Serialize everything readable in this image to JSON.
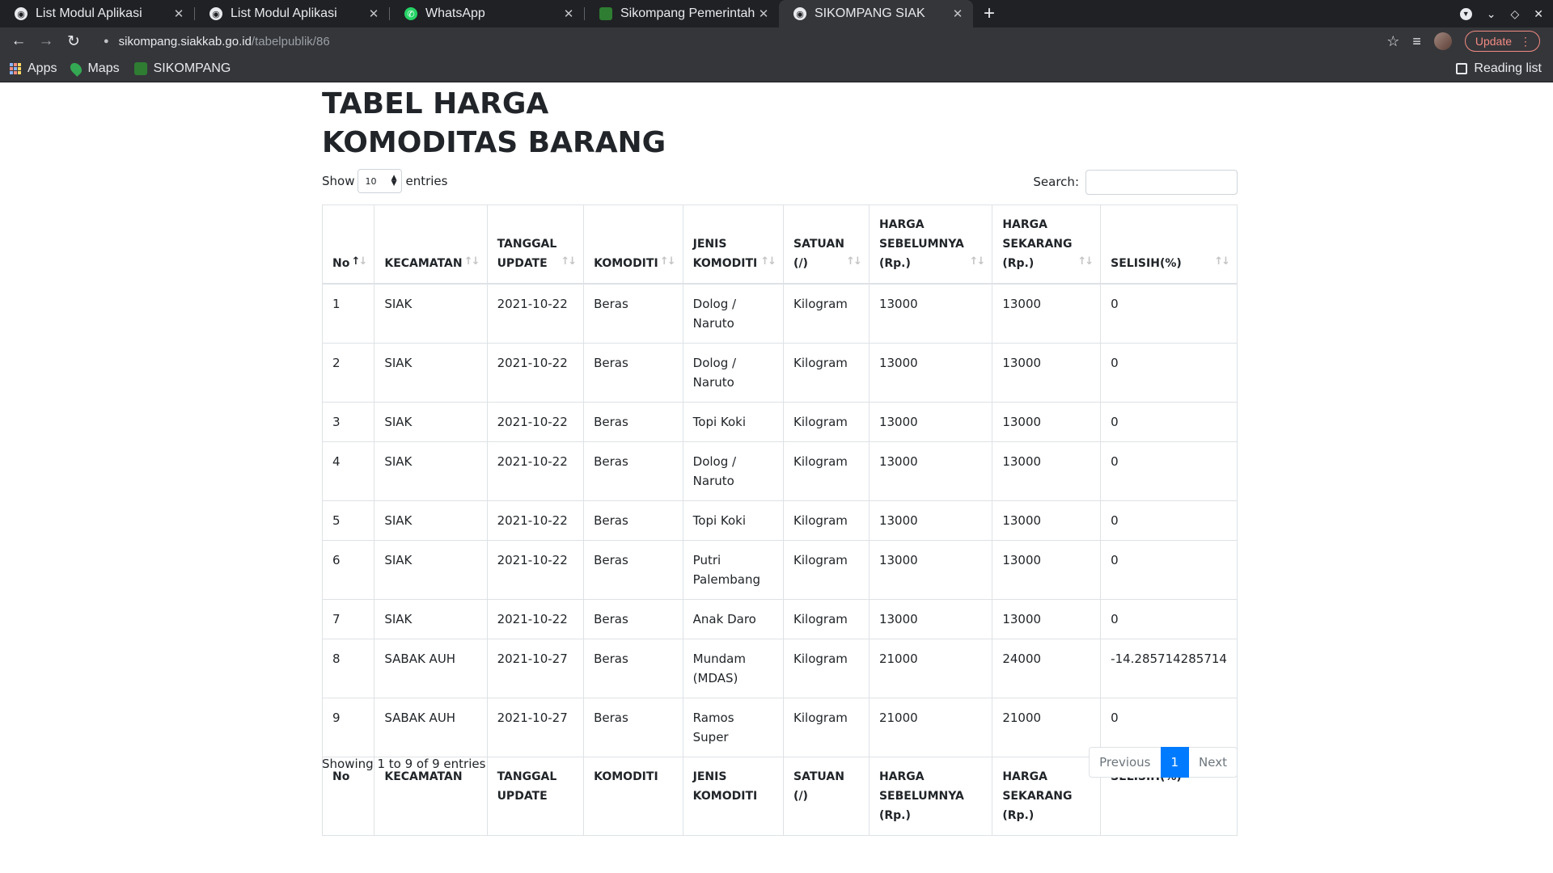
{
  "browser": {
    "tabs": [
      {
        "title": "List Modul Aplikasi",
        "icon": "globe-icon",
        "active": false
      },
      {
        "title": "List Modul Aplikasi",
        "icon": "globe-icon",
        "active": false
      },
      {
        "title": "WhatsApp",
        "icon": "whatsapp-icon",
        "active": false
      },
      {
        "title": "Sikompang Pemerintah K",
        "icon": "sikompang-icon",
        "active": false
      },
      {
        "title": "SIKOMPANG SIAK",
        "icon": "globe-icon",
        "active": true
      }
    ],
    "url_host": "sikompang.siakkab.go.id",
    "url_path": "/tabelpublik/86",
    "update_label": "Update",
    "bookmarks": [
      {
        "label": "Apps",
        "icon": "apps-grid-icon"
      },
      {
        "label": "Maps",
        "icon": "maps-pin-icon"
      },
      {
        "label": "SIKOMPANG",
        "icon": "sikompang-icon"
      }
    ],
    "reading_list_label": "Reading list"
  },
  "page": {
    "title": "TABEL HARGA KOMODITAS BARANG",
    "show_label": "Show",
    "entries_label": "entries",
    "page_length": "10",
    "search_label": "Search:",
    "search_value": "",
    "info": "Showing 1 to 9 of 9 entries",
    "pagination": {
      "previous": "Previous",
      "current": "1",
      "next": "Next"
    }
  },
  "table": {
    "headers": [
      "No",
      "KECAMATAN",
      "TANGGAL UPDATE",
      "KOMODITI",
      "JENIS KOMODITI",
      "SATUAN (/)",
      "HARGA SEBELUMNYA (Rp.)",
      "HARGA SEKARANG (Rp.)",
      "SELISIH(%)"
    ],
    "sorted_column": 0,
    "rows": [
      [
        "1",
        "SIAK",
        "2021-10-22",
        "Beras",
        "Dolog / Naruto",
        "Kilogram",
        "13000",
        "13000",
        "0"
      ],
      [
        "2",
        "SIAK",
        "2021-10-22",
        "Beras",
        "Dolog / Naruto",
        "Kilogram",
        "13000",
        "13000",
        "0"
      ],
      [
        "3",
        "SIAK",
        "2021-10-22",
        "Beras",
        "Topi Koki",
        "Kilogram",
        "13000",
        "13000",
        "0"
      ],
      [
        "4",
        "SIAK",
        "2021-10-22",
        "Beras",
        "Dolog / Naruto",
        "Kilogram",
        "13000",
        "13000",
        "0"
      ],
      [
        "5",
        "SIAK",
        "2021-10-22",
        "Beras",
        "Topi Koki",
        "Kilogram",
        "13000",
        "13000",
        "0"
      ],
      [
        "6",
        "SIAK",
        "2021-10-22",
        "Beras",
        "Putri Palembang",
        "Kilogram",
        "13000",
        "13000",
        "0"
      ],
      [
        "7",
        "SIAK",
        "2021-10-22",
        "Beras",
        "Anak Daro",
        "Kilogram",
        "13000",
        "13000",
        "0"
      ],
      [
        "8",
        "SABAK AUH",
        "2021-10-27",
        "Beras",
        "Mundam (MDAS)",
        "Kilogram",
        "21000",
        "24000",
        "-14.285714285714"
      ],
      [
        "9",
        "SABAK AUH",
        "2021-10-27",
        "Beras",
        "Ramos Super",
        "Kilogram",
        "21000",
        "21000",
        "0"
      ]
    ]
  }
}
